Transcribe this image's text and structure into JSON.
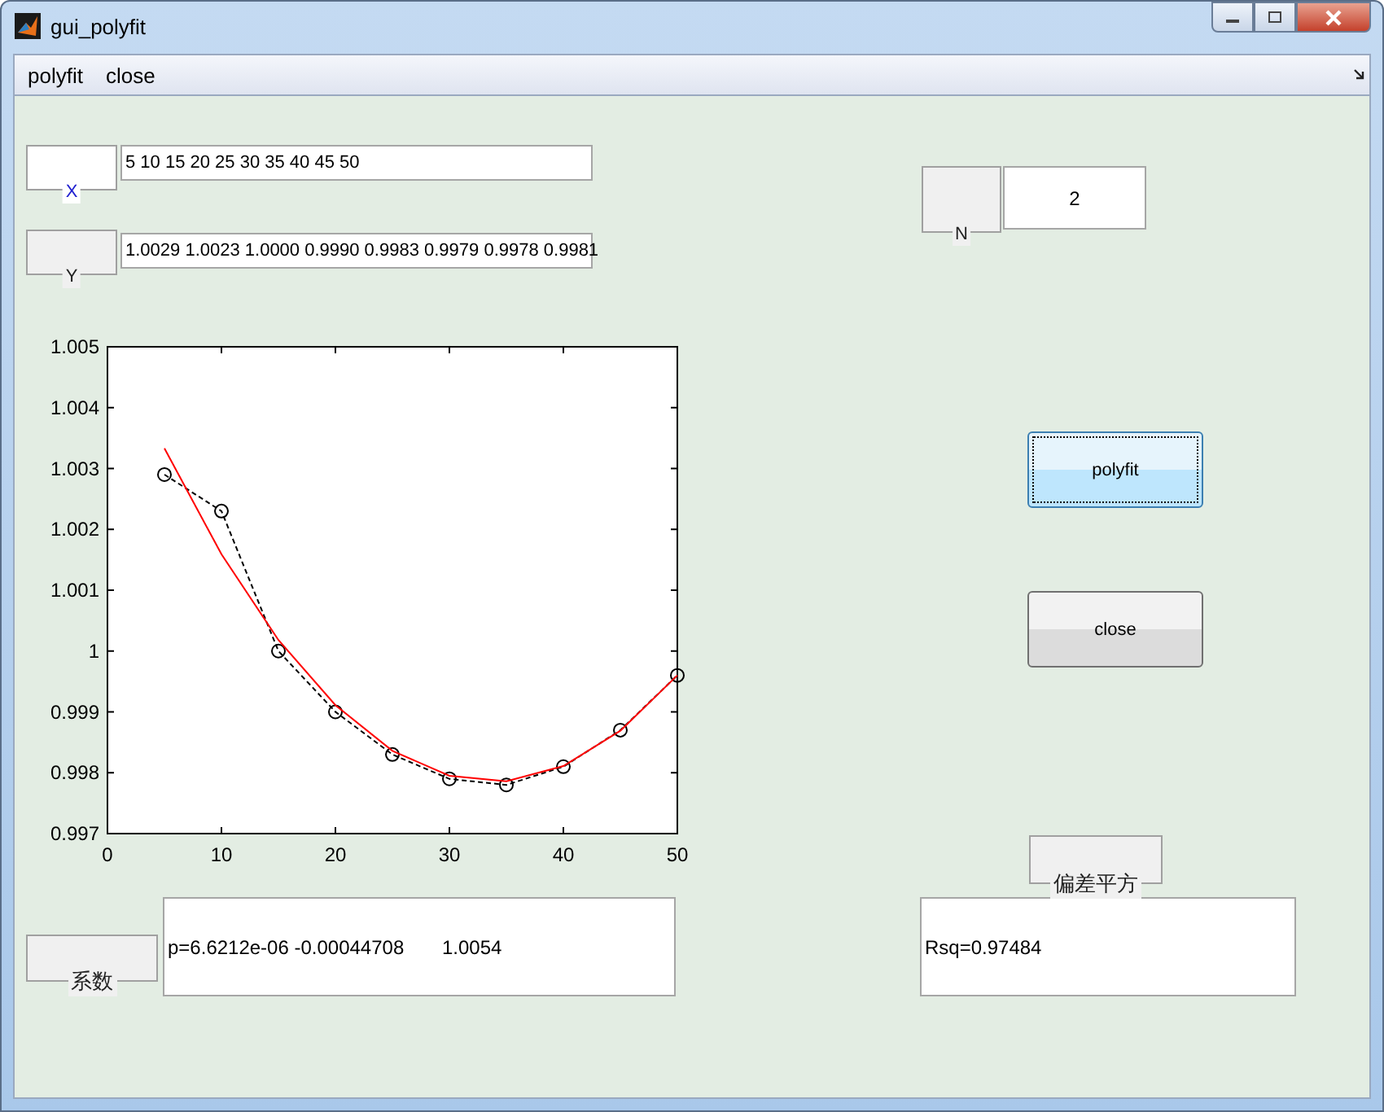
{
  "window": {
    "title": "gui_polyfit"
  },
  "menu": [
    "polyfit",
    "close"
  ],
  "inputs": [
    {
      "label": "X",
      "value": "5 10 15 20 25 30 35 40 45 50"
    },
    {
      "label": "Y",
      "value": "1.0029 1.0023 1.0000 0.9990 0.9983 0.9979 0.9978 0.9981"
    }
  ],
  "order": {
    "label": "N",
    "value": "2"
  },
  "buttons": [
    {
      "label": "polyfit",
      "focused": true
    },
    {
      "label": "close",
      "focused": false
    }
  ],
  "plot": {
    "chart_data": {
      "type": "line",
      "x": [
        5,
        10,
        15,
        20,
        25,
        30,
        35,
        40,
        45,
        50
      ],
      "xlim": [
        0,
        50
      ],
      "ylim": [
        0.997,
        1.005
      ],
      "xticks": [
        0,
        10,
        20,
        30,
        40,
        50
      ],
      "yticks": [
        {
          "value": 0.997,
          "label": "0.997"
        },
        {
          "value": 0.998,
          "label": "0.998"
        },
        {
          "value": 0.999,
          "label": "0.999"
        },
        {
          "value": 1,
          "label": "1"
        },
        {
          "value": 1.001,
          "label": "1.001"
        },
        {
          "value": 1.002,
          "label": "1.002"
        },
        {
          "value": 1.003,
          "label": "1.003"
        },
        {
          "value": 1.004,
          "label": "1.004"
        },
        {
          "value": 1.005,
          "label": "1.005"
        }
      ],
      "series": [
        {
          "color": "#000000",
          "line_style": "dashed",
          "marker": "circle",
          "values": [
            1.0029,
            1.0023,
            1.0,
            0.999,
            0.9983,
            0.9979,
            0.9978,
            0.9981,
            0.9987,
            0.9996
          ]
        },
        {
          "color": "#ff0000",
          "line_style": "solid",
          "marker": "none",
          "values": [
            1.00333,
            1.00159,
            1.00018,
            0.99911,
            0.99836,
            0.99795,
            0.99786,
            0.99811,
            0.99869,
            0.9996
          ]
        }
      ]
    }
  },
  "coefficients": {
    "label": "系数",
    "value": "p=6.6212e-06 -0.00044708       1.0054"
  },
  "residual": {
    "label": "偏差平方",
    "value": "Rsq=0.97484"
  }
}
